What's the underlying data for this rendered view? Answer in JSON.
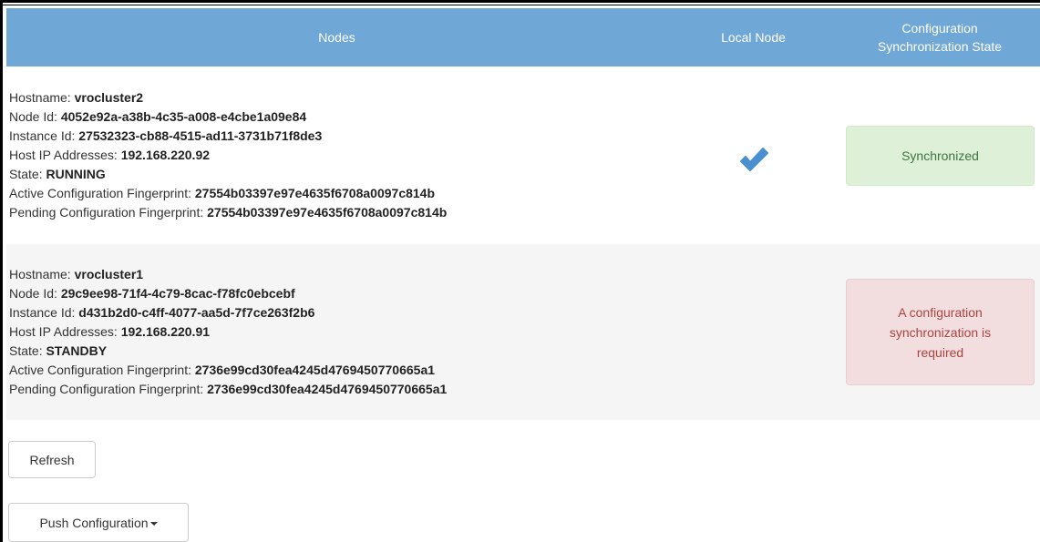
{
  "table": {
    "headers": {
      "nodes": "Nodes",
      "local_node": "Local Node",
      "sync_state_line1": "Configuration",
      "sync_state_line2": "Synchronization State"
    },
    "field_labels": {
      "hostname": "Hostname: ",
      "node_id": "Node Id: ",
      "instance_id": "Instance Id: ",
      "host_ip": "Host IP Addresses: ",
      "state": "State: ",
      "active_fp": "Active Configuration Fingerprint: ",
      "pending_fp": "Pending Configuration Fingerprint: "
    },
    "rows": [
      {
        "hostname": "vrocluster2",
        "node_id": "4052e92a-a38b-4c35-a008-e4cbe1a09e84",
        "instance_id": "27532323-cb88-4515-ad11-3731b71f8de3",
        "host_ip": "192.168.220.92",
        "state": "RUNNING",
        "active_fp": "27554b03397e97e4635f6708a0097c814b",
        "pending_fp": "27554b03397e97e4635f6708a0097c814b",
        "is_local": true,
        "local_icon": "checkmark-icon",
        "sync_status": "Synchronized",
        "sync_color": "#3c763d"
      },
      {
        "hostname": "vrocluster1",
        "node_id": "29c9ee98-71f4-4c79-8cac-f78fc0ebcebf",
        "instance_id": "d431b2d0-c4ff-4077-aa5d-7f7ce263f2b6",
        "host_ip": "192.168.220.91",
        "state": "STANDBY",
        "active_fp": "2736e99cd30fea4245d4769450770665a1",
        "pending_fp": "2736e99cd30fea4245d4769450770665a1",
        "is_local": false,
        "sync_status_line1": "A configuration",
        "sync_status_line2": "synchronization is",
        "sync_status_line3": "required",
        "sync_color": "#a94442"
      }
    ]
  },
  "buttons": {
    "refresh": "Refresh",
    "push_configuration": "Push Configuration",
    "push_icon": "caret-down-icon"
  },
  "colors": {
    "header_bg": "#6fa8d6",
    "check_color": "#4a8fd0",
    "success_bg": "#dff0d8",
    "danger_bg": "#f2dede"
  }
}
